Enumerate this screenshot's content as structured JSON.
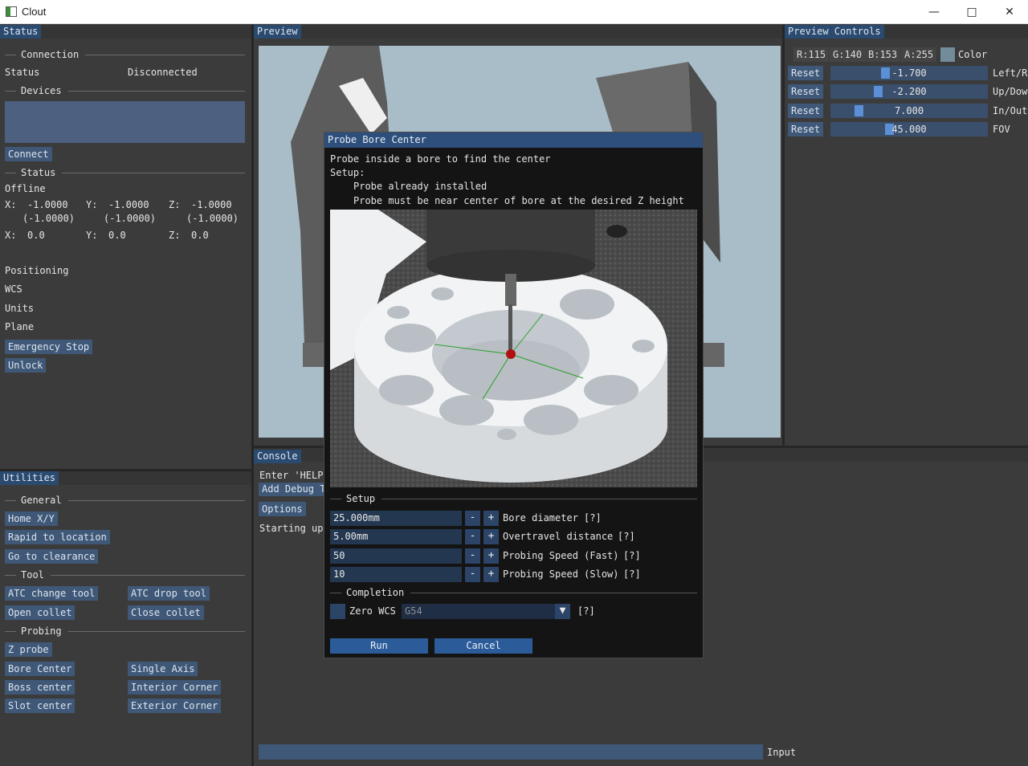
{
  "window": {
    "title": "Clout",
    "minimize_icon": "minimize-icon",
    "maximize_icon": "maximize-icon",
    "close_icon": "close-icon"
  },
  "status_panel": {
    "header": "Status",
    "connection_section": "Connection",
    "status_label": "Status",
    "status_value": "Disconnected",
    "devices_section": "Devices",
    "connect_button": "Connect",
    "status_section": "Status",
    "state": "Offline",
    "coords": {
      "x_label": "X:",
      "x_value": "-1.0000",
      "x_machine": "(-1.0000)",
      "y_label": "Y:",
      "y_value": "-1.0000",
      "y_machine": "(-1.0000)",
      "z_label": "Z:",
      "z_value": "-1.0000",
      "z_machine": "(-1.0000)",
      "x2_label": "X:",
      "x2_value": "0.0",
      "y2_label": "Y:",
      "y2_value": "0.0",
      "z2_label": "Z:",
      "z2_value": "0.0"
    },
    "positioning_label": "Positioning",
    "wcs_label": "WCS",
    "units_label": "Units",
    "plane_label": "Plane",
    "emergency_stop_button": "Emergency Stop",
    "unlock_button": "Unlock"
  },
  "utilities_panel": {
    "header": "Utilities",
    "general_section": "General",
    "home_xy_button": "Home X/Y",
    "rapid_to_location_button": "Rapid to location",
    "go_to_clearance_button": "Go to clearance",
    "tool_section": "Tool",
    "atc_change_tool_button": "ATC change tool",
    "atc_drop_tool_button": "ATC drop tool",
    "open_collet_button": "Open collet",
    "close_collet_button": "Close collet",
    "probing_section": "Probing",
    "z_probe_button": "Z probe",
    "bore_center_button": "Bore Center",
    "single_axis_button": "Single Axis",
    "boss_center_button": "Boss center",
    "interior_corner_button": "Interior Corner",
    "slot_center_button": "Slot center",
    "exterior_corner_button": "Exterior Corner"
  },
  "preview_panel": {
    "header": "Preview"
  },
  "console_panel": {
    "header": "Console",
    "enter_help_text": "Enter 'HELP",
    "add_debug_button": "Add Debug T",
    "options_button": "Options",
    "starting_text": "Starting up",
    "input_label": "Input"
  },
  "preview_controls": {
    "header": "Preview Controls",
    "color": {
      "r": "R:115",
      "g": "G:140",
      "b": "B:153",
      "a": "A:255",
      "label": "Color",
      "swatch": "#738c99"
    },
    "rows": [
      {
        "reset": "Reset",
        "value": "-1.700",
        "label": "Left/R",
        "fraction": 0.34
      },
      {
        "reset": "Reset",
        "value": "-2.200",
        "label": "Up/Dow",
        "fraction": 0.29
      },
      {
        "reset": "Reset",
        "value": "7.000",
        "label": "In/Out",
        "fraction": 0.16
      },
      {
        "reset": "Reset",
        "value": "45.000",
        "label": "FOV",
        "fraction": 0.37
      }
    ]
  },
  "probe_dialog": {
    "title": "Probe Bore Center",
    "description": "Probe inside a bore to find the center",
    "setup_label": "Setup:",
    "setup_line1": "Probe already installed",
    "setup_line2": "Probe must be near center of bore at the desired Z height",
    "setup_section": "Setup",
    "fields": [
      {
        "value": "25.000mm",
        "minus": "-",
        "plus": "+",
        "label": "Bore diameter",
        "help": "[?]"
      },
      {
        "value": "5.00mm",
        "minus": "-",
        "plus": "+",
        "label": "Overtravel distance",
        "help": "[?]"
      },
      {
        "value": "50",
        "minus": "-",
        "plus": "+",
        "label": "Probing Speed (Fast)",
        "help": "[?]"
      },
      {
        "value": "10",
        "minus": "-",
        "plus": "+",
        "label": "Probing Speed (Slow)",
        "help": "[?]"
      }
    ],
    "completion_section": "Completion",
    "zero_wcs_label": "Zero WCS",
    "wcs_selected": "G54",
    "wcs_help": "[?]",
    "run_button": "Run",
    "cancel_button": "Cancel"
  }
}
